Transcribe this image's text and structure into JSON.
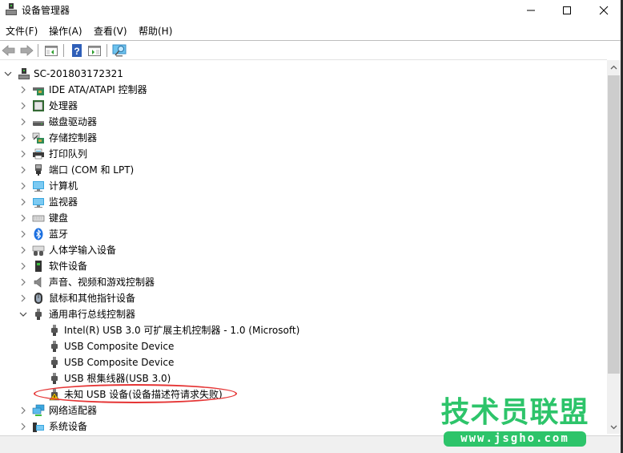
{
  "window": {
    "title": "设备管理器",
    "icons": {
      "app": "device-manager-icon",
      "minimize": "minimize-icon",
      "maximize": "maximize-icon",
      "close": "close-icon"
    }
  },
  "menu": {
    "items": [
      {
        "label": "文件(F)"
      },
      {
        "label": "操作(A)"
      },
      {
        "label": "查看(V)"
      },
      {
        "label": "帮助(H)"
      }
    ]
  },
  "toolbar": {
    "buttons": [
      {
        "name": "back-button",
        "icon": "arrow-left-icon"
      },
      {
        "name": "forward-button",
        "icon": "arrow-right-icon"
      },
      {
        "name": "show-hide-console-tree-button",
        "icon": "console-tree-icon"
      },
      {
        "name": "help-button",
        "icon": "help-icon"
      },
      {
        "name": "show-action-pane-button",
        "icon": "action-pane-icon"
      },
      {
        "name": "scan-hardware-button",
        "icon": "monitor-scan-icon"
      }
    ]
  },
  "tree": {
    "root": {
      "label": "SC-201803172321",
      "expanded": true,
      "icon": "computer-icon"
    },
    "categories": [
      {
        "label": "IDE ATA/ATAPI 控制器",
        "icon": "ide-controller-icon",
        "expanded": false
      },
      {
        "label": "处理器",
        "icon": "processor-icon",
        "expanded": false
      },
      {
        "label": "磁盘驱动器",
        "icon": "disk-drive-icon",
        "expanded": false
      },
      {
        "label": "存储控制器",
        "icon": "storage-controller-icon",
        "expanded": false
      },
      {
        "label": "打印队列",
        "icon": "printer-icon",
        "expanded": false
      },
      {
        "label": "端口 (COM 和 LPT)",
        "icon": "port-icon",
        "expanded": false
      },
      {
        "label": "计算机",
        "icon": "computer-monitor-icon",
        "expanded": false
      },
      {
        "label": "监视器",
        "icon": "monitor-icon",
        "expanded": false
      },
      {
        "label": "键盘",
        "icon": "keyboard-icon",
        "expanded": false
      },
      {
        "label": "蓝牙",
        "icon": "bluetooth-icon",
        "expanded": false
      },
      {
        "label": "人体学输入设备",
        "icon": "hid-icon",
        "expanded": false
      },
      {
        "label": "软件设备",
        "icon": "software-device-icon",
        "expanded": false
      },
      {
        "label": "声音、视频和游戏控制器",
        "icon": "speaker-icon",
        "expanded": false
      },
      {
        "label": "鼠标和其他指针设备",
        "icon": "mouse-icon",
        "expanded": false
      },
      {
        "label": "通用串行总线控制器",
        "icon": "usb-icon",
        "expanded": true,
        "children": [
          {
            "label": "Intel(R) USB 3.0 可扩展主机控制器 - 1.0 (Microsoft)",
            "icon": "usb-icon"
          },
          {
            "label": "USB Composite Device",
            "icon": "usb-icon"
          },
          {
            "label": "USB Composite Device",
            "icon": "usb-icon"
          },
          {
            "label": "USB 根集线器(USB 3.0)",
            "icon": "usb-icon"
          },
          {
            "label": "未知 USB 设备(设备描述符请求失败)",
            "icon": "usb-warning-icon",
            "warning": true,
            "highlighted": true
          }
        ]
      },
      {
        "label": "网络适配器",
        "icon": "network-adapter-icon",
        "expanded": false
      },
      {
        "label": "系统设备",
        "icon": "system-device-icon",
        "expanded": false
      }
    ]
  },
  "watermark": {
    "title": "技术员联盟",
    "url": "www.jsgho.com",
    "color": "#2dc46a"
  },
  "colors": {
    "annotation": "#e53535",
    "selection": "#ffffff"
  }
}
